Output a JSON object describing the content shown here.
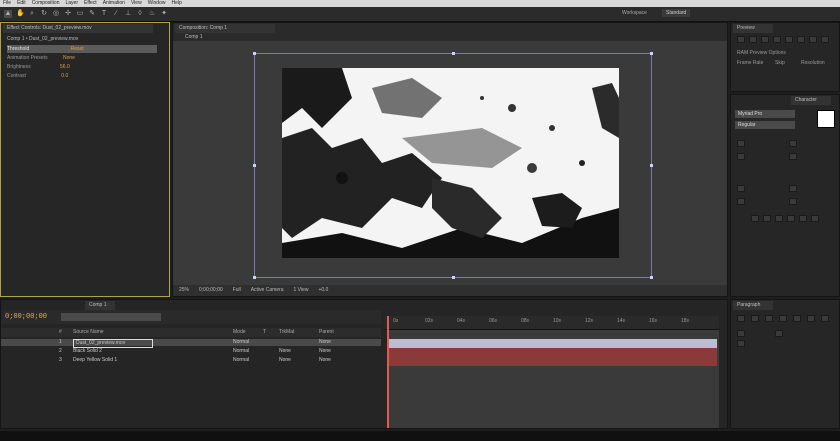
{
  "menu": [
    "File",
    "Edit",
    "Composition",
    "Layer",
    "Effect",
    "Animation",
    "View",
    "Window",
    "Help"
  ],
  "project": {
    "tab": "Effect Controls: Dust_02_preview.mov",
    "breadcrumb": "Comp 1 • Dust_02_preview.mov",
    "rows": [
      {
        "name": "Threshold",
        "value": "Reset"
      },
      {
        "name": "Animation Presets",
        "value": "None"
      },
      {
        "name": "Brightness",
        "value": "56.0"
      },
      {
        "name": "Contrast",
        "value": "0.0"
      }
    ]
  },
  "comp": {
    "tab": "Composition: Comp 1",
    "breadcrumb": "Comp 1",
    "workspace": "Workspace",
    "workspace_value": "Standard",
    "viewer_bar": [
      "25%",
      "0;00;00;00",
      "Full",
      "Active Camera",
      "1 View",
      "+0.0"
    ]
  },
  "preview": {
    "tab": "Preview",
    "label": "RAM Preview Options",
    "frame_rate": "Frame Rate",
    "skip": "Skip",
    "resolution": "Resolution"
  },
  "character": {
    "tab": "Character",
    "font": "Myriad Pro",
    "style": "Regular"
  },
  "paragraph": {
    "tab": "Paragraph"
  },
  "timeline": {
    "tab": "Comp 1",
    "timecode": "0;00;00;00",
    "columns": [
      "#",
      "Source Name",
      "Mode",
      "T",
      "TrkMat",
      "Parent"
    ],
    "layers": [
      {
        "num": "1",
        "name": "Dust_02_preview.mov",
        "mode": "Normal",
        "trkmat": "",
        "parent": "None",
        "color": "#7a3a3a"
      },
      {
        "num": "2",
        "name": "Black Solid 2",
        "mode": "Normal",
        "trkmat": "None",
        "parent": "None",
        "color": "#6b2f2f"
      },
      {
        "num": "3",
        "name": "Deep Yellow Solid 1",
        "mode": "Normal",
        "trkmat": "None",
        "parent": "None",
        "color": "#7a3a3a"
      }
    ],
    "ruler_ticks": [
      "0s",
      "02s",
      "04s",
      "06s",
      "08s",
      "10s",
      "12s",
      "14s",
      "16s",
      "18s"
    ]
  },
  "colors": {
    "accent": "#e0b640",
    "playhead": "#e25a4a",
    "track": "#8b3a3a"
  }
}
